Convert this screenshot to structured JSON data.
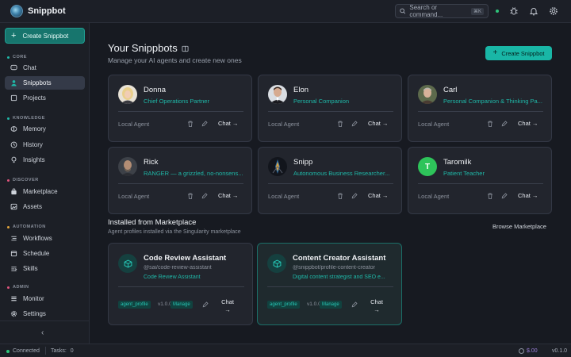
{
  "app": {
    "name": "Snippbot"
  },
  "topbar": {
    "search_placeholder": "Search or command...",
    "search_kbd": "⌘K",
    "icons": [
      "bug-icon",
      "bell-icon",
      "gear-icon"
    ]
  },
  "sidebar": {
    "create_label": "Create Snippbot",
    "sections": [
      {
        "title": "CORE",
        "color": "#1fb8a8",
        "items": [
          {
            "label": "Chat",
            "icon": "chat-icon"
          },
          {
            "label": "Snippbots",
            "icon": "user-icon",
            "active": true
          },
          {
            "label": "Projects",
            "icon": "square-icon"
          }
        ]
      },
      {
        "title": "KNOWLEDGE",
        "color": "#1fb8a8",
        "items": [
          {
            "label": "Memory",
            "icon": "brain-icon"
          },
          {
            "label": "History",
            "icon": "clock-icon"
          },
          {
            "label": "Insights",
            "icon": "lightbulb-icon"
          }
        ]
      },
      {
        "title": "DISCOVER",
        "color": "#e0547d",
        "items": [
          {
            "label": "Marketplace",
            "icon": "bag-icon"
          },
          {
            "label": "Assets",
            "icon": "image-icon"
          }
        ]
      },
      {
        "title": "AUTOMATION",
        "color": "#e0a33a",
        "items": [
          {
            "label": "Workflows",
            "icon": "workflow-icon"
          },
          {
            "label": "Schedule",
            "icon": "calendar-icon"
          },
          {
            "label": "Skills",
            "icon": "skills-icon"
          }
        ]
      },
      {
        "title": "ADMIN",
        "color": "#e0547d",
        "items": [
          {
            "label": "Monitor",
            "icon": "monitor-icon"
          },
          {
            "label": "Settings",
            "icon": "gear-icon"
          }
        ]
      }
    ],
    "collapse_glyph": "‹"
  },
  "header": {
    "title": "Your Snippbots",
    "subtitle": "Manage your AI agents and create new ones",
    "create_label": "Create Snippbot"
  },
  "bots": [
    {
      "name": "Donna",
      "role": "Chief Operations Partner",
      "type": "Local Agent",
      "chat": "Chat →"
    },
    {
      "name": "Elon",
      "role": "Personal Companion",
      "type": "Local Agent",
      "chat": "Chat →"
    },
    {
      "name": "Carl",
      "role": "Personal Companion & Thinking Pa...",
      "type": "Local Agent",
      "chat": "Chat →"
    },
    {
      "name": "Rick",
      "role": "RANGER — a grizzled, no-nonsens...",
      "type": "Local Agent",
      "chat": "Chat →"
    },
    {
      "name": "Snipp",
      "role": "Autonomous Business Researcher...",
      "type": "Local Agent",
      "chat": "Chat →"
    },
    {
      "name": "Taromilk",
      "role": "Patient Teacher",
      "type": "Local Agent",
      "chat": "Chat →",
      "initial": "T"
    }
  ],
  "marketplace": {
    "title": "Installed from Marketplace",
    "subtitle": "Agent profiles installed via the Singularity marketplace",
    "browse_label": "Browse Marketplace",
    "items": [
      {
        "name": "Code Review Assistant",
        "handle": "@sai/code-review-assistant",
        "desc": "Code Review Assistant",
        "tag": "agent_profile",
        "version": "v1.0.0",
        "manage": "Manage",
        "chat": "Chat",
        "arrow": "→"
      },
      {
        "name": "Content Creator Assistant",
        "handle": "@snippbot/profile-content-creator",
        "desc": "Digital content strategist and SEO e...",
        "tag": "agent_profile",
        "version": "v1.0.0",
        "manage": "Manage",
        "chat": "Chat",
        "arrow": "→"
      }
    ]
  },
  "statusbar": {
    "connection": "Connected",
    "tasks_label": "Tasks:",
    "tasks_count": "0",
    "cost": "$.00",
    "version": "v0.1.0"
  },
  "colors": {
    "accent": "#1fb8a8",
    "status_ok": "#2ec47a"
  }
}
